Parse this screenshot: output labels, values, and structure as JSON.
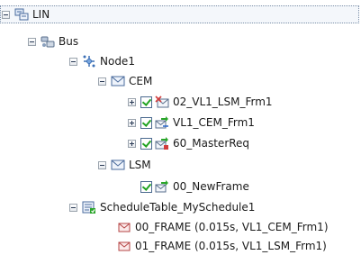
{
  "tree": {
    "root": {
      "label": "LIN"
    },
    "bus": {
      "label": "Bus"
    },
    "node1": {
      "label": "Node1"
    },
    "cem": {
      "label": "CEM"
    },
    "frame_02": {
      "label": "02_VL1_LSM_Frm1"
    },
    "frame_vl1cem": {
      "label": "VL1_CEM_Frm1"
    },
    "frame_60": {
      "label": "60_MasterReq"
    },
    "lsm": {
      "label": "LSM"
    },
    "frame_00new": {
      "label": "00_NewFrame"
    },
    "schedule": {
      "label": "ScheduleTable_MySchedule1"
    },
    "sched_entries": [
      {
        "label": "00_FRAME (0.015s, VL1_CEM_Frm1)"
      },
      {
        "label": "01_FRAME (0.015s, VL1_LSM_Frm1)"
      }
    ]
  },
  "colors": {
    "selection_outline": "#7a8ea8",
    "check_green": "#21a321",
    "arrow_green": "#2aa52a",
    "mail_red": "#d23c3c"
  }
}
